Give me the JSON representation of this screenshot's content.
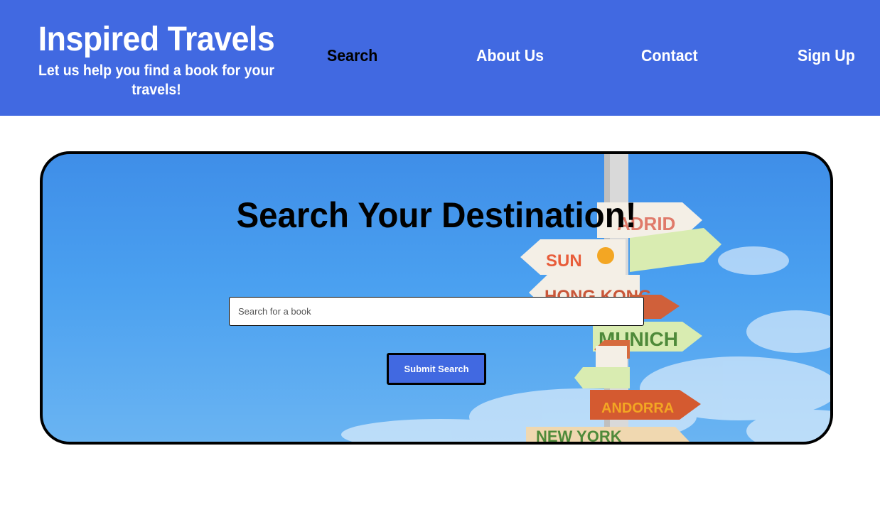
{
  "header": {
    "title": "Inspired Travels",
    "tagline": "Let us help you find a book for your travels!",
    "nav": [
      {
        "label": "Search",
        "active": true
      },
      {
        "label": "About Us",
        "active": false
      },
      {
        "label": "Contact",
        "active": false
      },
      {
        "label": "Sign Up",
        "active": false
      }
    ]
  },
  "hero": {
    "title": "Search Your Destination!",
    "search_placeholder": "Search for a book",
    "search_value": "",
    "submit_label": "Submit Search",
    "signpost_signs": [
      "MADRID",
      "SUN",
      "HONG KONG",
      "MUNICH",
      "NEW YORK"
    ]
  },
  "colors": {
    "brand": "#4169e1",
    "nav_active": "#000000",
    "nav_inactive": "#ffffff",
    "hero_sky": "#4aa0f0"
  }
}
